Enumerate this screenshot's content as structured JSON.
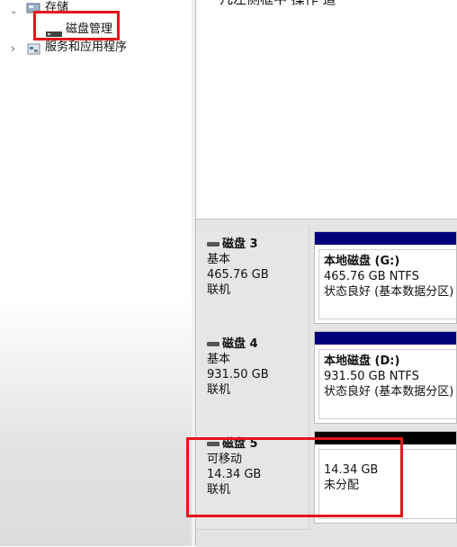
{
  "tree": {
    "storage_label": "存储",
    "disk_mgmt_label": "磁盘管理",
    "services_label": "服务和应用程序"
  },
  "upper_text": "几左侧框中   操作   道",
  "disks": [
    {
      "name": "磁盘 3",
      "type": "基本",
      "size": "465.76 GB",
      "status": "联机",
      "partition": {
        "name": "本地磁盘 (G:)",
        "detail": "465.76 GB NTFS",
        "status": "状态良好 (基本数据分区)",
        "bar_color": "#00007b"
      }
    },
    {
      "name": "磁盘 4",
      "type": "基本",
      "size": "931.50 GB",
      "status": "联机",
      "partition": {
        "name": "本地磁盘 (D:)",
        "detail": "931.50 GB NTFS",
        "status": "状态良好 (基本数据分区)",
        "bar_color": "#00007b"
      }
    },
    {
      "name": "磁盘 5",
      "type": "可移动",
      "size": "14.34 GB",
      "status": "联机",
      "partition": {
        "name": "",
        "detail": "14.34 GB",
        "status": "未分配",
        "bar_color": "#000000"
      }
    }
  ],
  "colors": {
    "highlight_red": "#e8141a",
    "basic_bar": "#00007b",
    "unallocated_bar": "#000000"
  },
  "icons": {
    "storage": "storage-icon",
    "disk_mgmt": "disk-management-icon",
    "services": "services-icon",
    "disk": "disk-icon"
  }
}
